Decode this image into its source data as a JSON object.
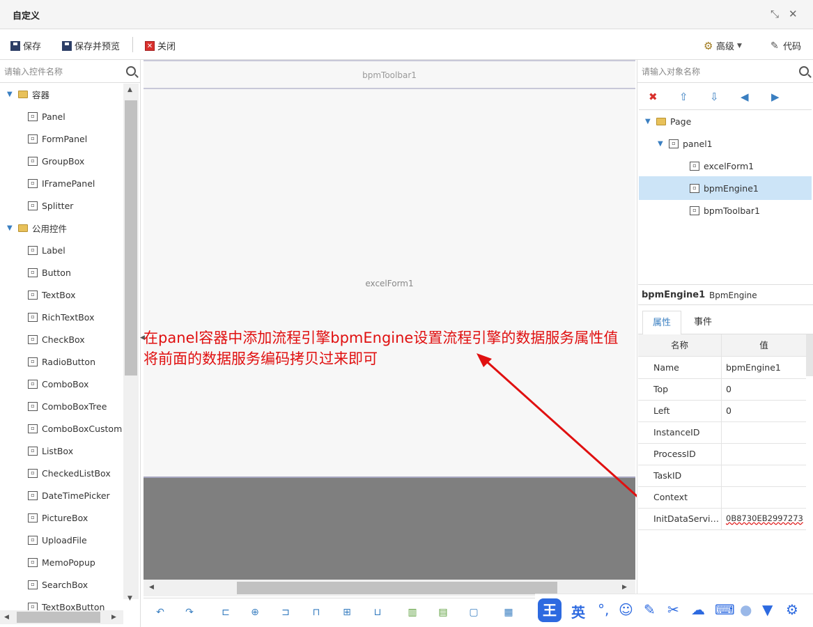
{
  "window": {
    "title": "自定义",
    "shrink_icon": "⤡",
    "close_icon": "✕"
  },
  "toolbar": {
    "save": "保存",
    "save_preview": "保存并预览",
    "close": "关闭",
    "advanced": "高级",
    "code": "代码"
  },
  "left": {
    "search_placeholder": "请输入控件名称",
    "groups": [
      {
        "label": "容器",
        "items": [
          "Panel",
          "FormPanel",
          "GroupBox",
          "IFramePanel",
          "Splitter"
        ]
      },
      {
        "label": "公用控件",
        "items": [
          "Label",
          "Button",
          "TextBox",
          "RichTextBox",
          "CheckBox",
          "RadioButton",
          "ComboBox",
          "ComboBoxTree",
          "ComboBoxCustom",
          "ListBox",
          "CheckedListBox",
          "DateTimePicker",
          "PictureBox",
          "UploadFile",
          "MemoPopup",
          "SearchBox",
          "TextBoxButton"
        ]
      }
    ]
  },
  "canvas": {
    "toolbar_label": "bpmToolbar1",
    "form_label": "excelForm1"
  },
  "annotation": {
    "line1": "在panel容器中添加流程引擎bpmEngine设置流程引擎的数据服务属性值",
    "line2": "将前面的数据服务编码拷贝过来即可"
  },
  "right": {
    "search_placeholder": "请输入对象名称",
    "tree": [
      {
        "label": "Page",
        "level": 0
      },
      {
        "label": "panel1",
        "level": 1
      },
      {
        "label": "excelForm1",
        "level": 2
      },
      {
        "label": "bpmEngine1",
        "level": 2,
        "selected": true
      },
      {
        "label": "bpmToolbar1",
        "level": 2
      }
    ],
    "selected_name": "bpmEngine1",
    "selected_type": "BpmEngine",
    "tabs": [
      "属性",
      "事件"
    ],
    "grid_header": {
      "name": "名称",
      "value": "值"
    },
    "properties": [
      {
        "name": "Name",
        "value": "bpmEngine1"
      },
      {
        "name": "Top",
        "value": "0"
      },
      {
        "name": "Left",
        "value": "0"
      },
      {
        "name": "InstanceID",
        "value": ""
      },
      {
        "name": "ProcessID",
        "value": ""
      },
      {
        "name": "TaskID",
        "value": ""
      },
      {
        "name": "Context",
        "value": ""
      },
      {
        "name": "InitDataServic...",
        "value": "0B8730EB2997273"
      }
    ]
  },
  "ime": {
    "logo": "王",
    "lang": "英"
  },
  "colors": {
    "accent": "#3a7fc1",
    "annotation": "#e01010",
    "selection": "#cce4f7"
  }
}
